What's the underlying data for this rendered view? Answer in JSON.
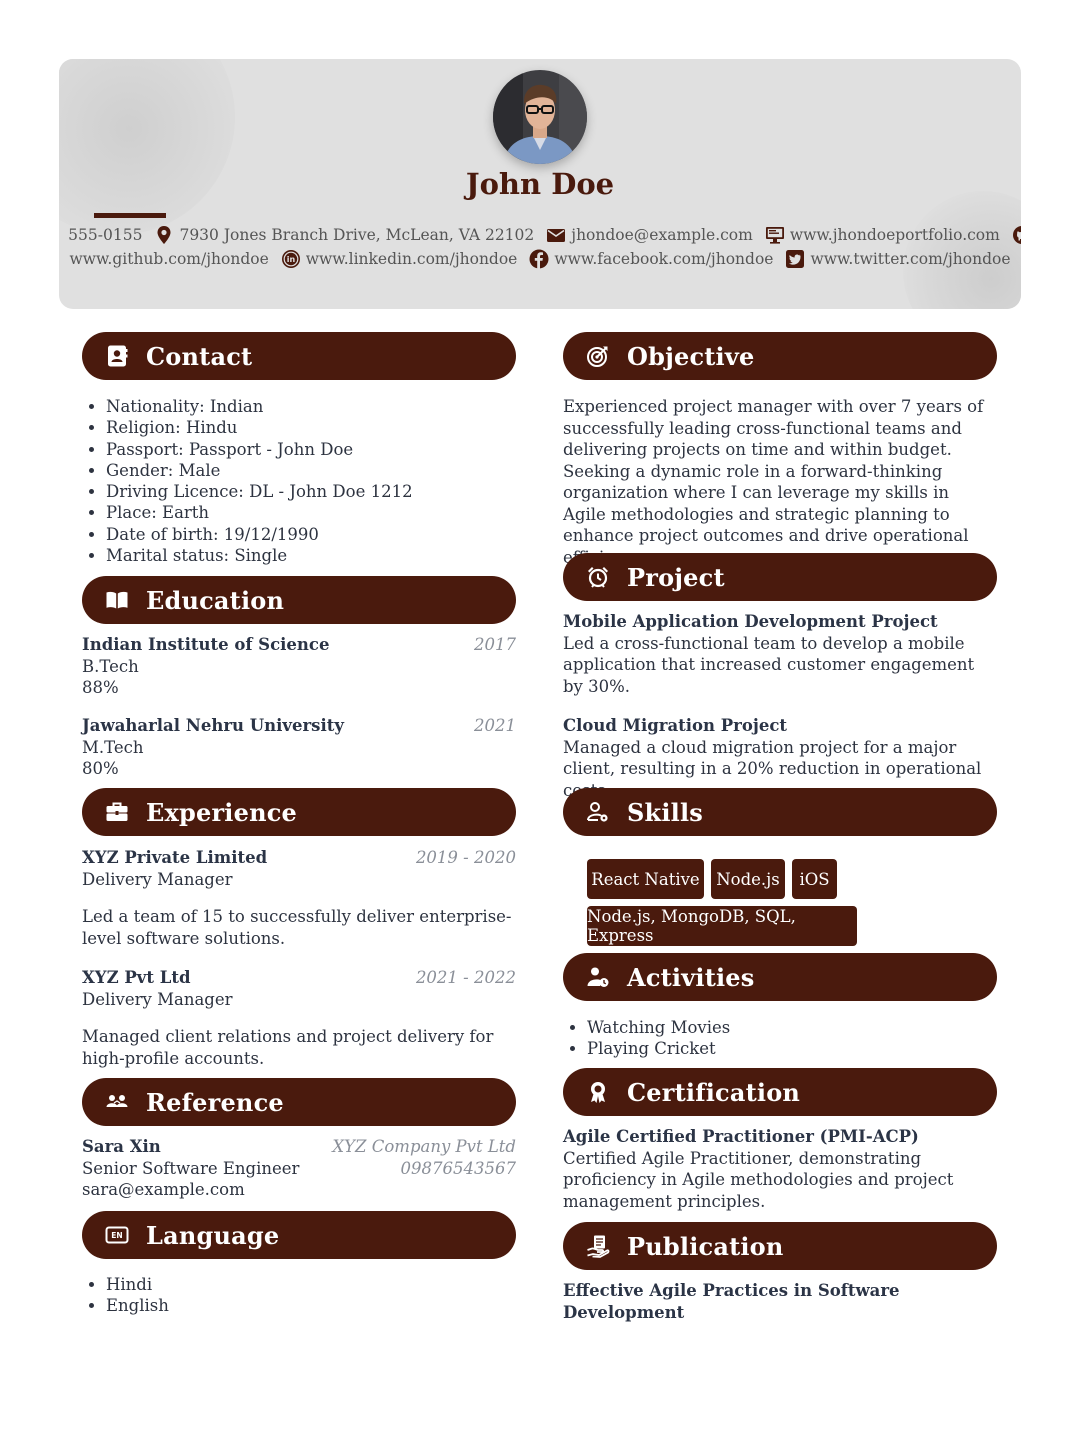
{
  "header": {
    "name": "John Doe",
    "phone": "555-0155",
    "address": "7930 Jones Branch Drive, McLean, VA 22102",
    "email": "jhondoe@example.com",
    "portfolio": "www.jhondoeportfolio.com",
    "github": "www.github.com/jhondoe",
    "linkedin": "www.linkedin.com/jhondoe",
    "facebook": "www.facebook.com/jhondoe",
    "twitter": "www.twitter.com/jhondoe"
  },
  "colors": {
    "accent": "#4a1a0d",
    "header_bg": "#e0e0e0",
    "muted": "#8a8f98"
  },
  "contact": {
    "title": "Contact",
    "icon": "address-book-icon",
    "items": [
      "Nationality: Indian",
      "Religion: Hindu",
      "Passport: Passport - John Doe",
      "Gender: Male",
      "Driving Licence: DL - John Doe 1212",
      "Place: Earth",
      "Date of birth: 19/12/1990",
      "Marital status: Single"
    ]
  },
  "education": {
    "title": "Education",
    "icon": "open-book-icon",
    "items": [
      {
        "school": "Indian Institute of Science",
        "year": "2017",
        "degree": "B.Tech",
        "score": "88%"
      },
      {
        "school": "Jawaharlal Nehru University",
        "year": "2021",
        "degree": "M.Tech",
        "score": "80%"
      }
    ]
  },
  "experience": {
    "title": "Experience",
    "icon": "briefcase-icon",
    "items": [
      {
        "company": "XYZ Private Limited",
        "dates": "2019 - 2020",
        "role": "Delivery Manager",
        "desc": "Led a team of 15 to successfully deliver enterprise-level software solutions."
      },
      {
        "company": "XYZ Pvt Ltd",
        "dates": "2021 - 2022",
        "role": "Delivery Manager",
        "desc": "Managed client relations and project delivery for high-profile accounts."
      }
    ]
  },
  "reference": {
    "title": "Reference",
    "icon": "people-icon",
    "name": "Sara Xin",
    "company": "XYZ Company Pvt Ltd",
    "position": "Senior Software Engineer",
    "phone": "09876543567",
    "email": "sara@example.com"
  },
  "language": {
    "title": "Language",
    "icon": "en-language-icon",
    "items": [
      "Hindi",
      "English"
    ]
  },
  "objective": {
    "title": "Objective",
    "icon": "target-icon",
    "text": "Experienced project manager with over 7 years of successfully leading cross-functional teams and delivering projects on time and within budget. Seeking a dynamic role in a forward-thinking organization where I can leverage my skills in Agile methodologies and strategic planning to enhance project outcomes and drive operational efficiency."
  },
  "project": {
    "title": "Project",
    "icon": "alarm-clock-icon",
    "items": [
      {
        "name": "Mobile Application Development Project",
        "desc": "Led a cross-functional team to develop a mobile application that increased customer engagement by 30%."
      },
      {
        "name": "Cloud Migration Project",
        "desc": "Managed a cloud migration project for a major client, resulting in a 20% reduction in operational costs."
      }
    ]
  },
  "skills": {
    "title": "Skills",
    "icon": "user-gear-icon",
    "items": [
      "React Native",
      "Node.js",
      "iOS",
      "Node.js, MongoDB, SQL, Express"
    ]
  },
  "activities": {
    "title": "Activities",
    "icon": "user-clock-icon",
    "items": [
      "Watching Movies",
      "Playing Cricket"
    ]
  },
  "certification": {
    "title": "Certification",
    "icon": "award-icon",
    "name": "Agile Certified Practitioner (PMI-ACP)",
    "desc": "Certified Agile Practitioner, demonstrating proficiency in Agile methodologies and project management principles."
  },
  "publication": {
    "title": "Publication",
    "icon": "hand-document-icon",
    "name": "Effective Agile Practices in Software Development"
  }
}
